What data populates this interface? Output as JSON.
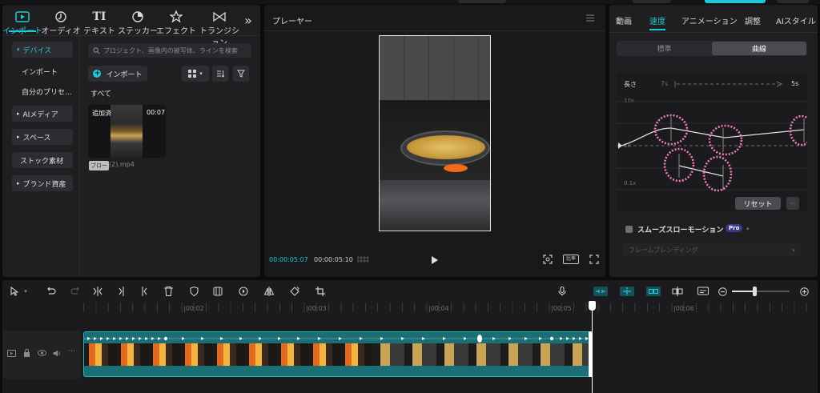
{
  "toolbar": {
    "tabs": [
      {
        "label": "インポート",
        "icon": "import-icon",
        "active": true
      },
      {
        "label": "オーディオ",
        "icon": "audio-icon"
      },
      {
        "label": "テキスト",
        "icon": "text-icon",
        "glyph": "TI"
      },
      {
        "label": "ステッカー",
        "icon": "sticker-icon"
      },
      {
        "label": "エフェクト",
        "icon": "effect-icon"
      },
      {
        "label": "トランジション",
        "icon": "transition-icon"
      }
    ],
    "more": "»"
  },
  "sidebar": {
    "items": [
      {
        "label": "デバイス",
        "active": true
      },
      {
        "label": "インポート"
      },
      {
        "label": "自分のプリセ..."
      },
      {
        "label": "AIメディア"
      },
      {
        "label": "スペース"
      },
      {
        "label": "ストック素材"
      },
      {
        "label": "ブランド資産"
      }
    ]
  },
  "media": {
    "search_placeholder": "プロジェクト、画像内の被写体、ラインを検索",
    "import_label": "インポート",
    "section_label": "すべて",
    "clip": {
      "added_badge": "追加済",
      "duration": "00:07",
      "tag": "ブロー",
      "filename": "(2).mp4"
    }
  },
  "player": {
    "title": "プレーヤー",
    "current_time": "00:00:05:07",
    "total_time": "00:00:05:10",
    "ratio_label": "比率"
  },
  "inspector": {
    "tabs": [
      "動画",
      "速度",
      "アニメーション",
      "調整",
      "AIスタイル"
    ],
    "active_tab": "速度",
    "mode_tabs": [
      "標準",
      "曲線"
    ],
    "active_mode": "曲線",
    "length_label": "長さ",
    "length_from": "7s",
    "length_to": "5s",
    "y_labels": [
      "10x",
      "1x",
      "0.1x"
    ],
    "reset_label": "リセット",
    "smooth_label": "スムーズスローモーション",
    "pro_badge": "Pro",
    "frame_blend": "フレームブレンディング"
  },
  "timeline": {
    "ruler": [
      "|00:02",
      "|00:03",
      "|00:04",
      "|00:05",
      "|00:06"
    ]
  },
  "colors": {
    "accent": "#20c9d6",
    "track": "#1a6e75",
    "annotation": "#f07fc0"
  }
}
